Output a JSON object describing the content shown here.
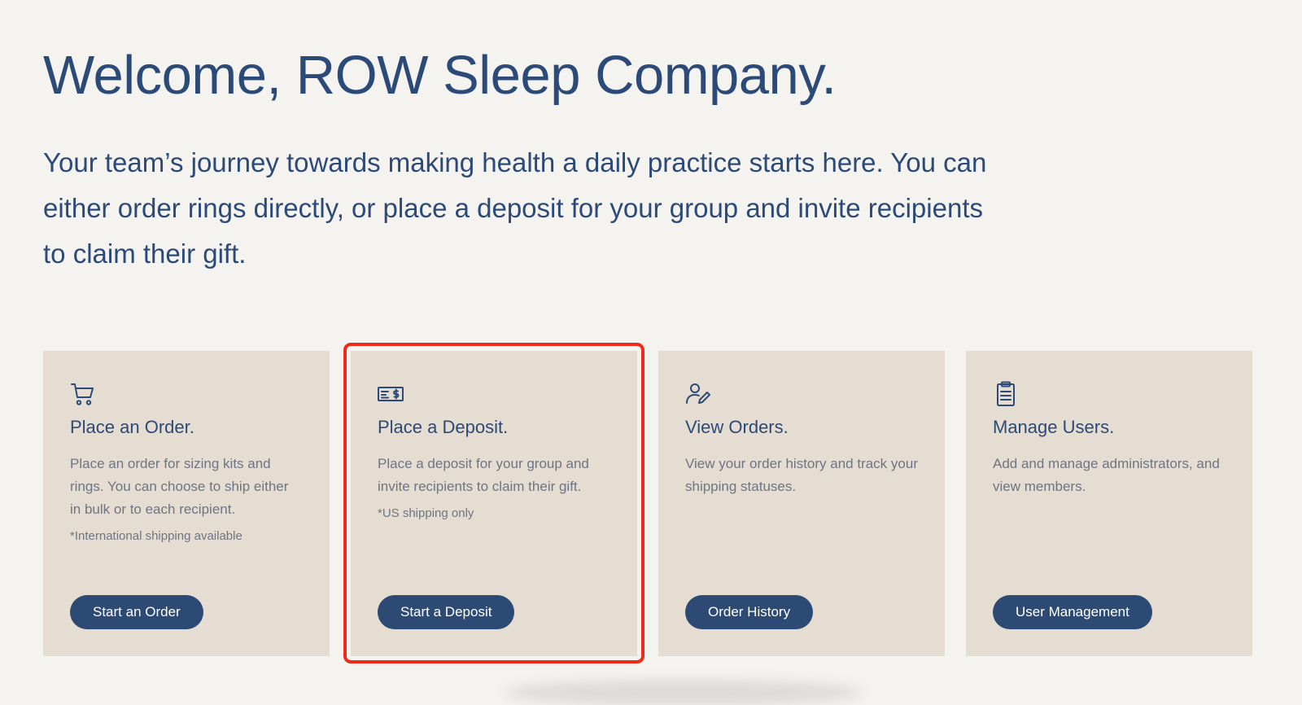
{
  "header": {
    "title": "Welcome, ROW Sleep Company.",
    "intro": "Your team’s journey towards making health a daily practice starts here. You can either order rings directly, or place a deposit for your group and invite recipients to claim their gift."
  },
  "cards": [
    {
      "icon": "shopping-cart-icon",
      "title": "Place an Order.",
      "description": "Place an order for sizing kits and rings. You can choose to ship either in bulk or to each recipient.",
      "note": "*International shipping available",
      "button_label": "Start an Order"
    },
    {
      "icon": "check-deposit-icon",
      "title": "Place a Deposit.",
      "description": "Place a deposit for your group and invite recipients to claim their gift.",
      "note": "*US shipping only",
      "button_label": "Start a Deposit",
      "highlighted": true
    },
    {
      "icon": "user-edit-icon",
      "title": "View Orders.",
      "description": "View your order history and track your shipping statuses.",
      "button_label": "Order History"
    },
    {
      "icon": "clipboard-icon",
      "title": "Manage Users.",
      "description": "Add and manage administrators, and view members.",
      "button_label": "User Management"
    }
  ],
  "colors": {
    "background": "#f5f3ef",
    "card": "#e6ddd2",
    "primary": "#2c4a74",
    "highlight": "#ee2a1b"
  }
}
